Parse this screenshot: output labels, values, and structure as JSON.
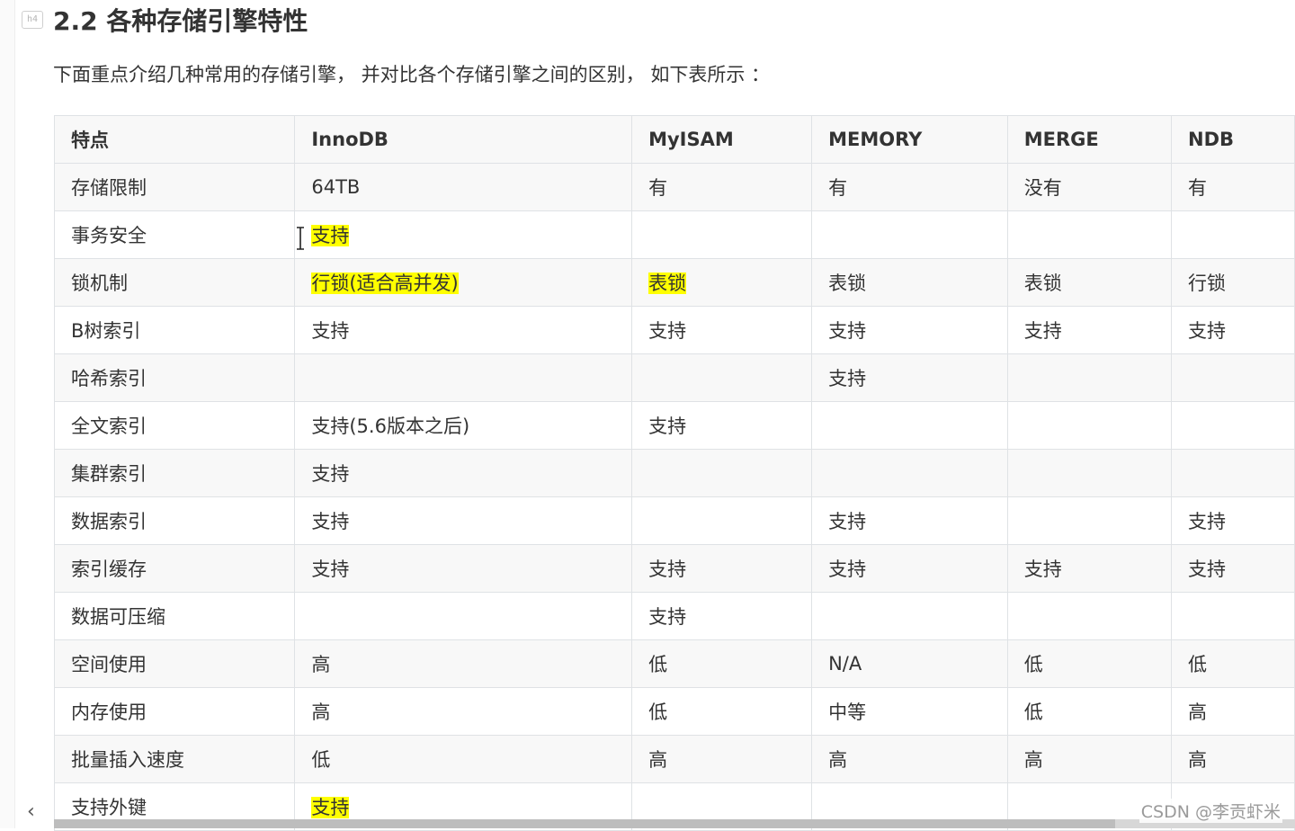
{
  "heading_marker": "h4",
  "heading": "2.2 各种存储引擎特性",
  "intro": "下面重点介绍几种常用的存储引擎， 并对比各个存储引擎之间的区别， 如下表所示 ：",
  "highlight_color": "#ffff00",
  "table": {
    "headers": [
      "特点",
      "InnoDB",
      "MyISAM",
      "MEMORY",
      "MERGE",
      "NDB"
    ],
    "rows": [
      [
        "存储限制",
        "64TB",
        "有",
        "有",
        "没有",
        "有"
      ],
      [
        "事务安全",
        "支持",
        "",
        "",
        "",
        ""
      ],
      [
        "锁机制",
        "行锁(适合高并发)",
        "表锁",
        "表锁",
        "表锁",
        "行锁"
      ],
      [
        "B树索引",
        "支持",
        "支持",
        "支持",
        "支持",
        "支持"
      ],
      [
        "哈希索引",
        "",
        "",
        "支持",
        "",
        ""
      ],
      [
        "全文索引",
        "支持(5.6版本之后)",
        "支持",
        "",
        "",
        ""
      ],
      [
        "集群索引",
        "支持",
        "",
        "",
        "",
        ""
      ],
      [
        "数据索引",
        "支持",
        "",
        "支持",
        "",
        "支持"
      ],
      [
        "索引缓存",
        "支持",
        "支持",
        "支持",
        "支持",
        "支持"
      ],
      [
        "数据可压缩",
        "",
        "支持",
        "",
        "",
        ""
      ],
      [
        "空间使用",
        "高",
        "低",
        "N/A",
        "低",
        "低"
      ],
      [
        "内存使用",
        "高",
        "低",
        "中等",
        "低",
        "高"
      ],
      [
        "批量插入速度",
        "低",
        "高",
        "高",
        "高",
        "高"
      ],
      [
        "支持外键",
        "支持",
        "",
        "",
        "",
        ""
      ]
    ]
  },
  "icons": {
    "text_cursor": "i-beam-cursor-icon",
    "scroll_left": "chevron-left-icon"
  },
  "scroll_left_glyph": "‹",
  "watermark": "CSDN @李贡虾米"
}
